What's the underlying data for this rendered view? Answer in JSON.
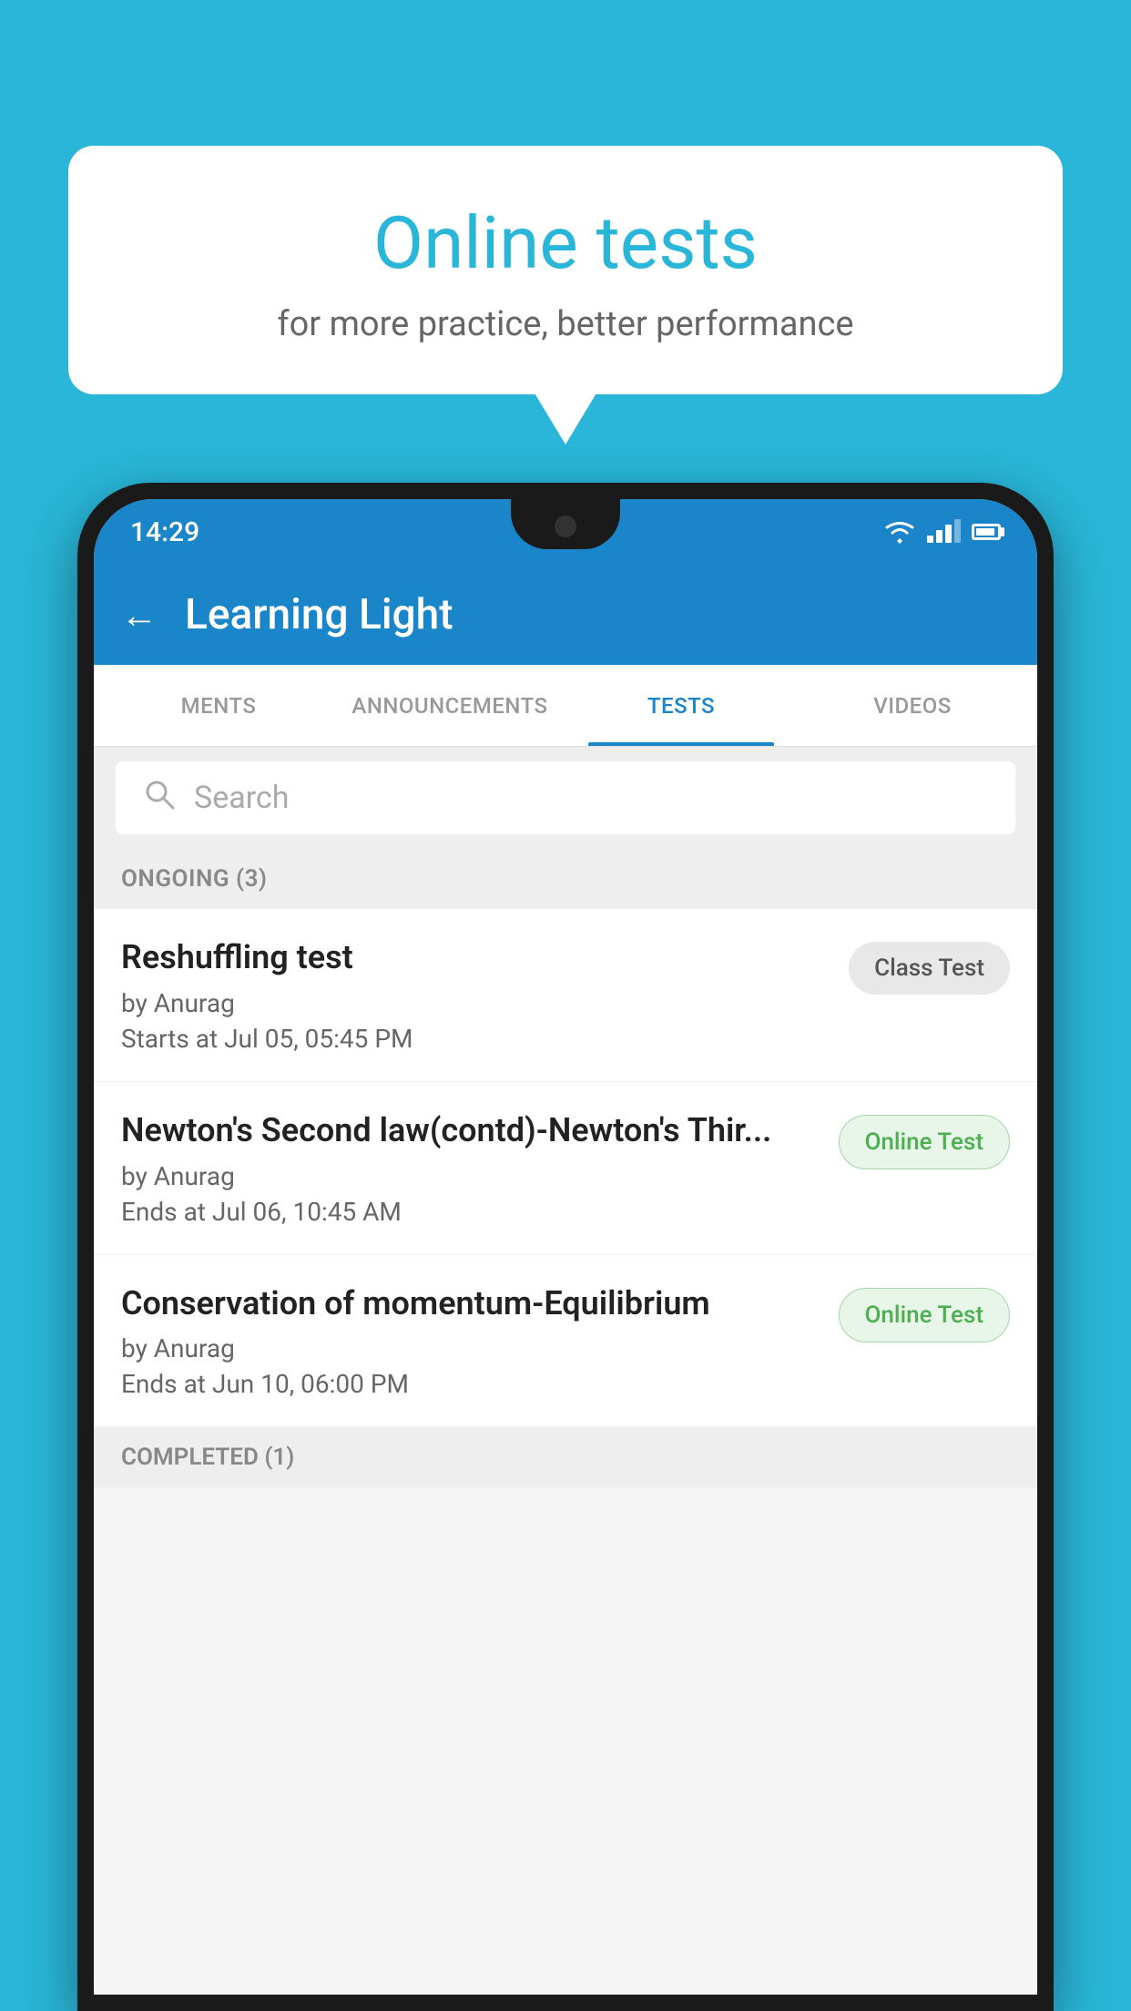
{
  "background_color": "#29b6d8",
  "speech_bubble": {
    "title": "Online tests",
    "subtitle": "for more practice, better performance"
  },
  "phone": {
    "status_bar": {
      "time": "14:29"
    },
    "app_bar": {
      "title": "Learning Light",
      "back_label": "←"
    },
    "tabs": [
      {
        "label": "MENTS",
        "active": false
      },
      {
        "label": "ANNOUNCEMENTS",
        "active": false
      },
      {
        "label": "TESTS",
        "active": true
      },
      {
        "label": "VIDEOS",
        "active": false
      }
    ],
    "search": {
      "placeholder": "Search"
    },
    "ongoing_section": {
      "header": "ONGOING (3)"
    },
    "tests": [
      {
        "name": "Reshuffling test",
        "author": "by Anurag",
        "time_label": "Starts at",
        "time": "Jul 05, 05:45 PM",
        "badge": "Class Test",
        "badge_type": "class"
      },
      {
        "name": "Newton's Second law(contd)-Newton's Thir...",
        "author": "by Anurag",
        "time_label": "Ends at",
        "time": "Jul 06, 10:45 AM",
        "badge": "Online Test",
        "badge_type": "online"
      },
      {
        "name": "Conservation of momentum-Equilibrium",
        "author": "by Anurag",
        "time_label": "Ends at",
        "time": "Jun 10, 06:00 PM",
        "badge": "Online Test",
        "badge_type": "online"
      }
    ],
    "completed_section": {
      "header": "COMPLETED (1)"
    }
  }
}
